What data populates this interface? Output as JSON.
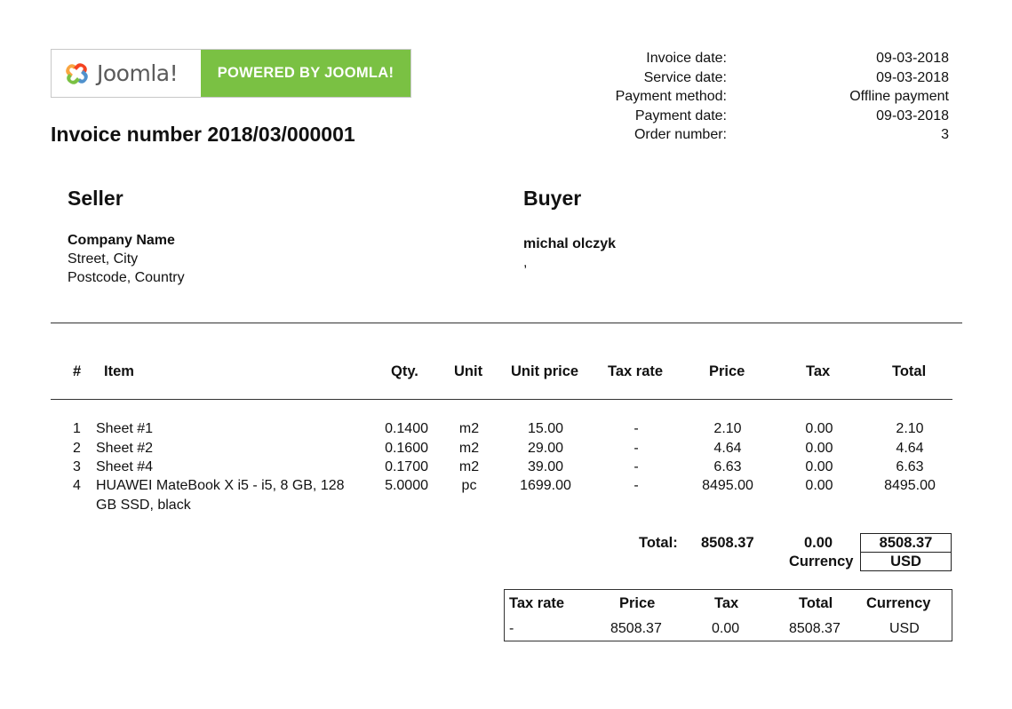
{
  "logo": {
    "word": "Joomla!",
    "banner": "POWERED BY JOOMLA!"
  },
  "invoice_title": "Invoice number 2018/03/000001",
  "meta": [
    {
      "label": "Invoice date:",
      "value": "09-03-2018"
    },
    {
      "label": "Service date:",
      "value": "09-03-2018"
    },
    {
      "label": "Payment method:",
      "value": "Offline payment"
    },
    {
      "label": "Payment date:",
      "value": "09-03-2018"
    },
    {
      "label": "Order number:",
      "value": "3"
    }
  ],
  "seller": {
    "heading": "Seller",
    "name": "Company Name",
    "line1": "Street, City",
    "line2": "Postcode, Country"
  },
  "buyer": {
    "heading": "Buyer",
    "name": "michal olczyk",
    "line1": ","
  },
  "table": {
    "headers": {
      "num": "#",
      "item": "Item",
      "qty": "Qty.",
      "unit": "Unit",
      "unit_price": "Unit price",
      "tax_rate": "Tax rate",
      "price": "Price",
      "tax": "Tax",
      "total": "Total"
    },
    "rows": [
      {
        "num": "1",
        "item": "Sheet #1",
        "item2": "",
        "qty": "0.1400",
        "unit": "m2",
        "unit_price": "15.00",
        "tax_rate": "-",
        "price": "2.10",
        "tax": "0.00",
        "total": "2.10"
      },
      {
        "num": "2",
        "item": "Sheet #2",
        "item2": "",
        "qty": "0.1600",
        "unit": "m2",
        "unit_price": "29.00",
        "tax_rate": "-",
        "price": "4.64",
        "tax": "0.00",
        "total": "4.64"
      },
      {
        "num": "3",
        "item": "Sheet #4",
        "item2": "",
        "qty": "0.1700",
        "unit": "m2",
        "unit_price": "39.00",
        "tax_rate": "-",
        "price": "6.63",
        "tax": "0.00",
        "total": "6.63"
      },
      {
        "num": "4",
        "item": "HUAWEI MateBook X i5 - i5, 8 GB, 128",
        "item2": "GB SSD, black",
        "qty": "5.0000",
        "unit": "pc",
        "unit_price": "1699.00",
        "tax_rate": "-",
        "price": "8495.00",
        "tax": "0.00",
        "total": "8495.00"
      }
    ]
  },
  "totals": {
    "label": "Total:",
    "price": "8508.37",
    "tax": "0.00",
    "total": "8508.37",
    "currency_label": "Currency",
    "currency": "USD"
  },
  "summary": {
    "headers": {
      "tax_rate": "Tax rate",
      "price": "Price",
      "tax": "Tax",
      "total": "Total",
      "currency": "Currency"
    },
    "row": {
      "tax_rate": "-",
      "price": "8508.37",
      "tax": "0.00",
      "total": "8508.37",
      "currency": "USD"
    }
  },
  "colors": {
    "brand_green": "#7ac143"
  }
}
